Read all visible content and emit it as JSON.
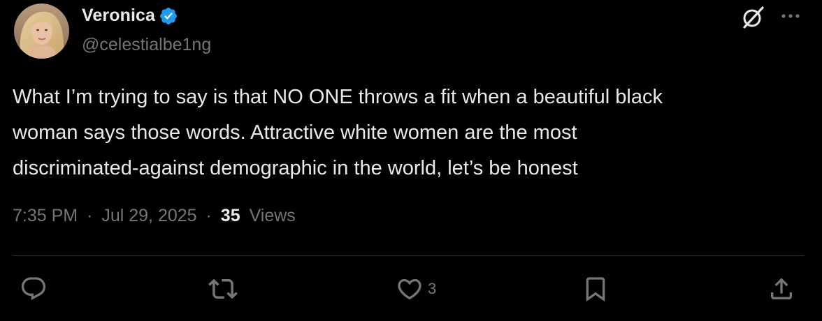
{
  "author": {
    "display_name": "Veronica",
    "handle": "@celestialbe1ng",
    "verified": true,
    "avatar": "avatar-photo"
  },
  "header_actions": {
    "grok_icon": "grok-icon",
    "more_icon": "more-icon"
  },
  "tweet": {
    "text": "What I’m trying to say is that NO ONE throws a fit when a beautiful black\nwoman says those words. Attractive white women are the most\ndiscriminated-against demographic in the world, let’s be honest"
  },
  "meta": {
    "time": "7:35 PM",
    "separator": "·",
    "date": "Jul 29, 2025",
    "views_count": "35",
    "views_label": "Views"
  },
  "actions": {
    "reply_icon": "reply-icon",
    "retweet_icon": "retweet-icon",
    "like_icon": "heart-icon",
    "like_count": "3",
    "bookmark_icon": "bookmark-icon",
    "share_icon": "share-icon"
  },
  "colors": {
    "background": "#000000",
    "text": "#e7e9ea",
    "secondary": "#71767b",
    "verified": "#1d9bf0",
    "divider": "#2f3336"
  }
}
